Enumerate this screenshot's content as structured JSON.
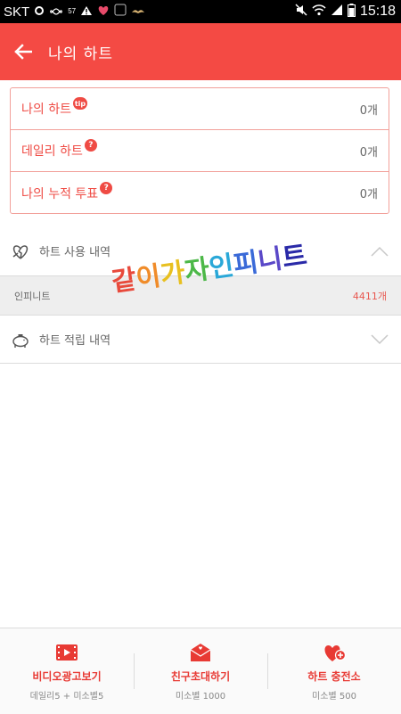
{
  "status_bar": {
    "carrier": "SKT",
    "indicator_57": "57",
    "time": "15:18"
  },
  "header": {
    "title": "나의 하트"
  },
  "stats": [
    {
      "label": "나의 하트",
      "badge": "tip",
      "value": "0개"
    },
    {
      "label": "데일리 하트",
      "badge": "?",
      "value": "0개"
    },
    {
      "label": "나의 누적 투표",
      "badge": "?",
      "value": "0개"
    }
  ],
  "sections": {
    "used": {
      "title": "하트 사용 내역"
    },
    "used_items": [
      {
        "name": "인피니트",
        "count": "4411개"
      }
    ],
    "earned": {
      "title": "하트 적립 내역"
    }
  },
  "watermark": {
    "chars": [
      "같",
      "이",
      "가",
      "자",
      "인",
      "피",
      "니",
      "트"
    ],
    "colors": [
      "#e84a3c",
      "#f08c2a",
      "#e8c020",
      "#4cb848",
      "#2aa8d8",
      "#3a6ad8",
      "#5a48c8",
      "#2a2aa8"
    ]
  },
  "bottom_bar": [
    {
      "icon": "video-icon",
      "label": "비디오광고보기",
      "sub": "데일리5 + 미소별5"
    },
    {
      "icon": "mail-icon",
      "label": "친구초대하기",
      "sub": "미소별 1000"
    },
    {
      "icon": "heart-plus-icon",
      "label": "하트 충전소",
      "sub": "미소별 500"
    }
  ],
  "colors": {
    "accent": "#f44a44",
    "border_pink": "#f2a09a"
  }
}
